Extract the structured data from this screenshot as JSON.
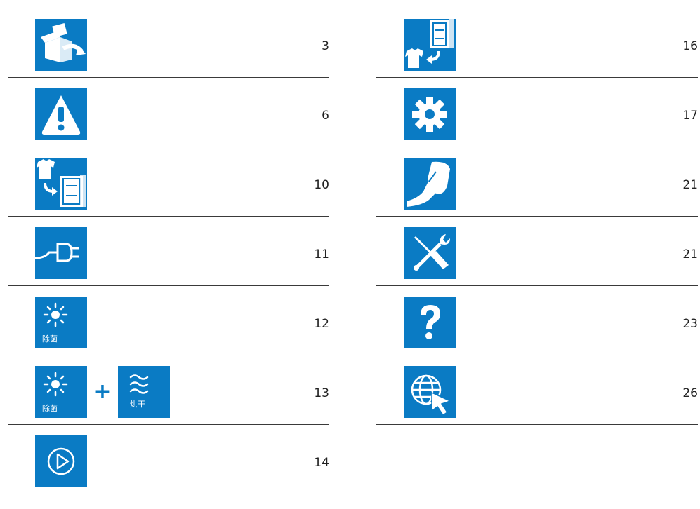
{
  "left_items": [
    {
      "icon": "box-unpacking-icon",
      "page": "3"
    },
    {
      "icon": "warning-icon",
      "page": "6"
    },
    {
      "icon": "shirt-to-cabinet-icon",
      "page": "10"
    },
    {
      "icon": "power-plug-icon",
      "page": "11"
    },
    {
      "icon": "sterilize-icon",
      "page": "12",
      "label": "除菌"
    },
    {
      "icon": "sterilize-icon",
      "page": "13",
      "label": "除菌",
      "plus": "+",
      "icon2": "dry-icon",
      "label2": "烘干"
    },
    {
      "icon": "play-icon",
      "page": "14"
    }
  ],
  "right_items": [
    {
      "icon": "cabinet-to-shirt-icon",
      "page": "16"
    },
    {
      "icon": "gear-icon",
      "page": "17"
    },
    {
      "icon": "cleaning-hand-icon",
      "page": "21"
    },
    {
      "icon": "tools-icon",
      "page": "21"
    },
    {
      "icon": "question-icon",
      "page": "23"
    },
    {
      "icon": "globe-cursor-icon",
      "page": "26"
    }
  ],
  "colors": {
    "icon_bg": "#0a7bc4",
    "rule": "#3a3a3a",
    "text": "#222222"
  }
}
